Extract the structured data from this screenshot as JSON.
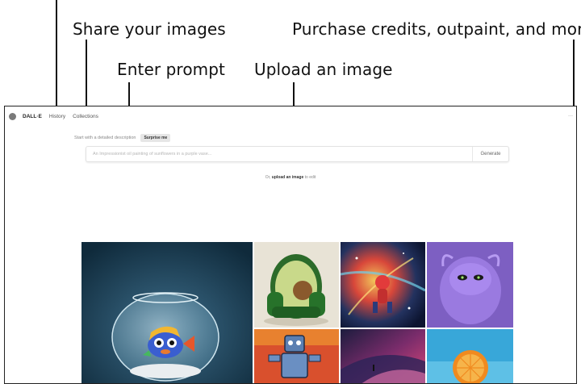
{
  "callouts": {
    "share": "Share your images",
    "purchase": "Purchase credits, outpaint, and more",
    "prompt": "Enter prompt",
    "upload": "Upload an image"
  },
  "nav": {
    "brand": "DALL·E",
    "history": "History",
    "collections": "Collections",
    "menu": "···"
  },
  "prompt": {
    "label": "Start with a detailed description",
    "surprise": "Surprise me",
    "placeholder": "An Impressionist oil painting of sunflowers in a purple vase...",
    "generate": "Generate"
  },
  "upload": {
    "prefix": "Or,",
    "link": "upload an image",
    "suffix": "to edit"
  },
  "gallery": {
    "tiles": [
      "fishbowl-image",
      "avocado-chair-image",
      "space-astronaut-image",
      "purple-monster-image",
      "robot-painting-image",
      "dunes-image",
      "orange-image"
    ]
  }
}
